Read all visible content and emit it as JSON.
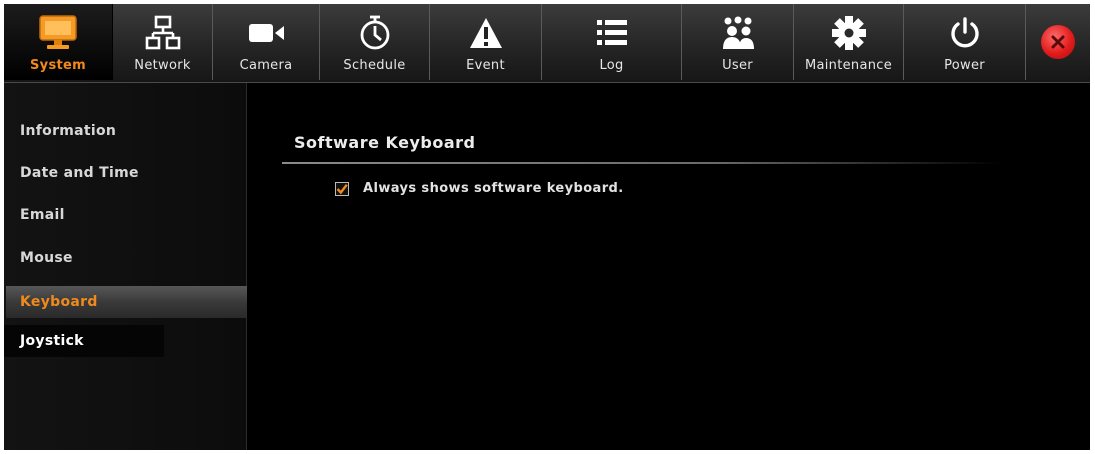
{
  "tabs": [
    {
      "label": "System",
      "icon": "monitor-icon",
      "active": true
    },
    {
      "label": "Network",
      "icon": "network-icon",
      "active": false
    },
    {
      "label": "Camera",
      "icon": "camera-icon",
      "active": false
    },
    {
      "label": "Schedule",
      "icon": "stopwatch-icon",
      "active": false
    },
    {
      "label": "Event",
      "icon": "warning-icon",
      "active": false
    },
    {
      "label": "Log",
      "icon": "list-icon",
      "active": false
    },
    {
      "label": "User",
      "icon": "users-icon",
      "active": false
    },
    {
      "label": "Maintenance",
      "icon": "gear-icon",
      "active": false
    },
    {
      "label": "Power",
      "icon": "power-icon",
      "active": false
    }
  ],
  "close": {
    "icon": "close-icon"
  },
  "sidebar": {
    "items": [
      {
        "label": "Information"
      },
      {
        "label": "Date and Time"
      },
      {
        "label": "Email"
      },
      {
        "label": "Mouse"
      },
      {
        "label": "Keyboard",
        "active": true
      },
      {
        "label": "Joystick"
      }
    ]
  },
  "main": {
    "section_title": "Software Keyboard",
    "option_label": "Always shows software keyboard.",
    "option_checked": true
  },
  "colors": {
    "accent": "#f08a1c",
    "close": "#e21c1c"
  }
}
